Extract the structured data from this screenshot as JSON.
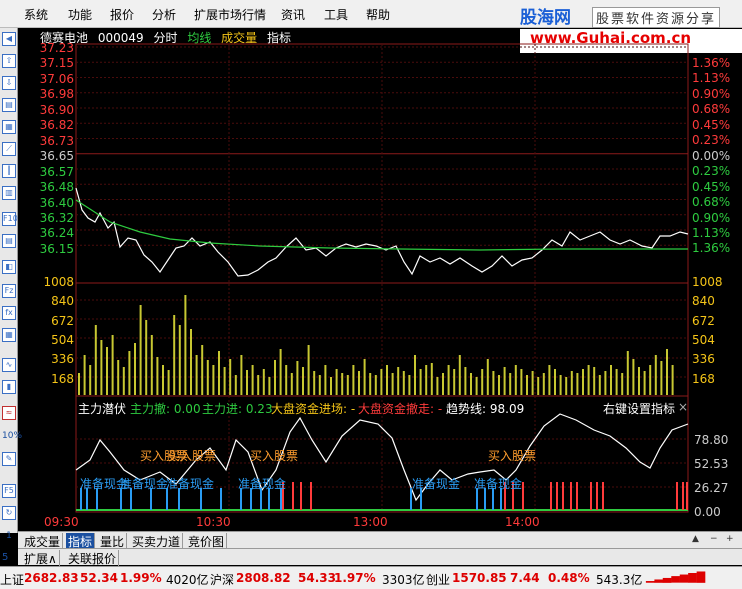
{
  "menu": [
    "系统",
    "功能",
    "报价",
    "分析",
    "扩展市场行情",
    "资讯",
    "工具",
    "帮助"
  ],
  "brand": {
    "logo": "股海网",
    "tagline": "股票软件资源分享",
    "url": "www.Guhai.com.cn"
  },
  "stock": {
    "name": "德赛电池",
    "code": "000049",
    "mode": "分时",
    "avg_label": "均线",
    "vol_label": "成交量",
    "ind_label": "指标"
  },
  "price_axis": [
    "37.23",
    "37.15",
    "37.06",
    "36.98",
    "36.90",
    "36.82",
    "36.73",
    "36.65",
    "36.57",
    "36.48",
    "36.40",
    "36.32",
    "36.24",
    "36.15"
  ],
  "pct_axis": [
    "1.36%",
    "1.13%",
    "0.90%",
    "0.68%",
    "0.45%",
    "0.23%",
    "0.00%",
    "0.23%",
    "0.45%",
    "0.68%",
    "0.90%",
    "1.13%",
    "1.36%"
  ],
  "vol_axis": [
    "1008",
    "840",
    "672",
    "504",
    "336",
    "168"
  ],
  "indicator": {
    "name": "主力潜伏",
    "withdraw": "主力撤: 0.00",
    "enter": "主力进: 0.23",
    "big_in": "大盘资金进场: -",
    "big_out": "大盘资金撤走: -",
    "trend": "趋势线: 98.09",
    "setting": "右键设置指标",
    "close": "×",
    "axis": [
      "78.80",
      "52.53",
      "26.27",
      "0.00"
    ],
    "labels_buy": [
      "买入股票",
      "买入股票",
      "买入股票",
      "买入股票"
    ],
    "labels_ready": [
      "准备现金",
      "准备现金",
      "准备现金",
      "准备现金",
      "准备现金",
      "准备现金"
    ]
  },
  "time_axis": [
    "09:30",
    "10:30",
    "13:00",
    "14:00"
  ],
  "tabs1": [
    "成交量",
    "指标",
    "量比",
    "买卖力道",
    "竞价图"
  ],
  "tabs1_active": "指标",
  "tabs2": [
    "扩展∧",
    "关联报价"
  ],
  "status": [
    {
      "name": "上证",
      "value": "2682.83",
      "change": "52.34",
      "pct": "1.99%",
      "amount": "4020亿"
    },
    {
      "name": "沪深",
      "value": "2808.82",
      "change": "54.33",
      "pct": "1.97%",
      "amount": "3303亿"
    },
    {
      "name": "创业",
      "value": "1570.85",
      "change": "7.44",
      "pct": "0.48%",
      "amount": "543.3亿"
    }
  ],
  "colors": {
    "up": "#ff3b3b",
    "price_line": "#ffffff",
    "avg_line": "#2ecc40",
    "volume": "#c8c832",
    "buy_label": "#ff9d2e",
    "ready_label": "#2a9df4",
    "trend": "#ffffff"
  }
}
